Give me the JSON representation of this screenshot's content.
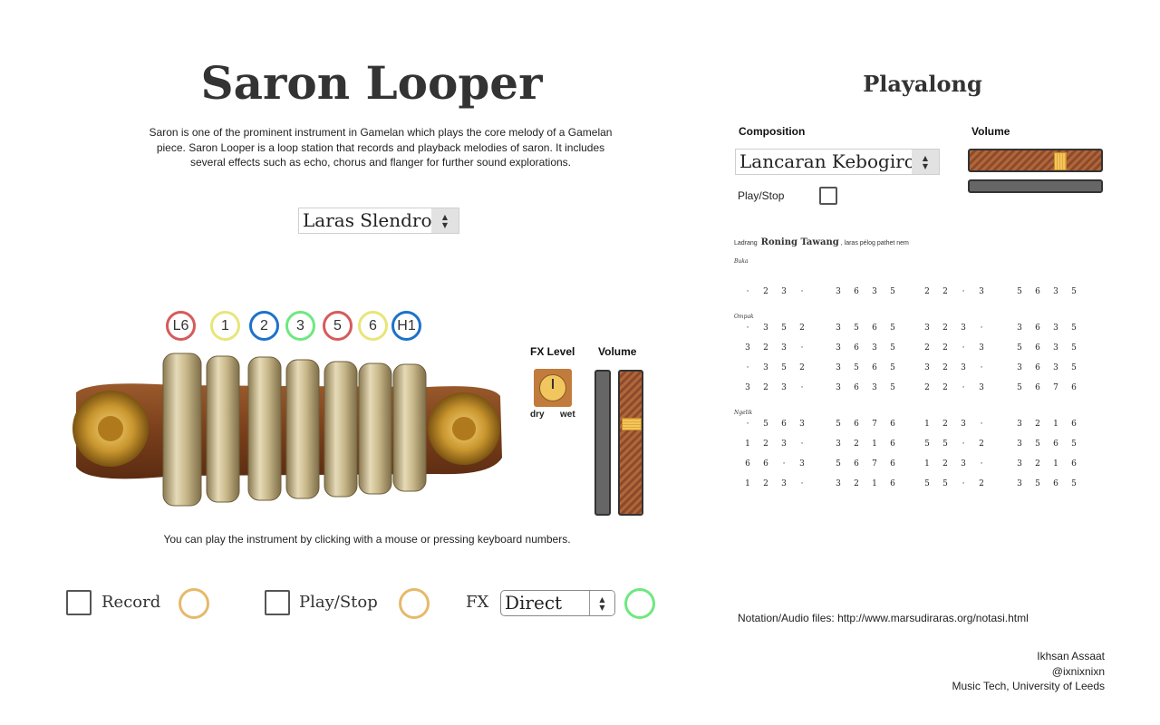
{
  "app": {
    "title": "Saron Looper",
    "description": "Saron is one of the prominent instrument in Gamelan which plays the core melody of a Gamelan piece. Saron Looper is a loop station that records and playback melodies of saron. It includes several effects such as echo, chorus and flanger for further sound explorations.",
    "laras_select": "Laras Slendro",
    "notes": [
      {
        "label": "L6",
        "color": "#d65b5b"
      },
      {
        "label": "1",
        "color": "#e8e57a"
      },
      {
        "label": "2",
        "color": "#1d72c9"
      },
      {
        "label": "3",
        "color": "#6ee87f"
      },
      {
        "label": "5",
        "color": "#d65b5b"
      },
      {
        "label": "6",
        "color": "#e8e57a"
      },
      {
        "label": "H1",
        "color": "#1d72c9"
      }
    ],
    "fx_level_label": "FX Level",
    "fx_dry": "dry",
    "fx_wet": "wet",
    "volume_label": "Volume",
    "hint": "You can play the instrument by clicking with a mouse or pressing keyboard numbers.",
    "record_label": "Record",
    "playstop_label": "Play/Stop",
    "fx_label": "FX",
    "fx_select": "Direct",
    "record_ring_color": "#e6b96a",
    "play_ring_color": "#e6b96a",
    "fx_ring_color": "#6ee87f",
    "volume_level_fraction": 0.65
  },
  "playalong": {
    "title": "Playalong",
    "composition_label": "Composition",
    "composition_select": "Lancaran Kebogiro",
    "volume_label": "Volume",
    "volume_level_fraction": 0.7,
    "playstop_label": "Play/Stop",
    "notation": {
      "header_prefix": "Ladrang",
      "header_title": "Roning Tawang",
      "header_suffix": ", laras pélog pathet nem",
      "buka_label": "Buka",
      "ompak_label": "Ompak",
      "ngelik_label": "Ngelik",
      "buka_rows": [
        [
          "·",
          "2",
          "3",
          "·",
          "3",
          "6",
          "3",
          "5",
          "2",
          "2",
          "·",
          "3",
          "5",
          "6",
          "3",
          "5"
        ]
      ],
      "ompak_rows": [
        [
          "·",
          "3",
          "5",
          "2",
          "3",
          "5",
          "6",
          "5",
          "3",
          "2",
          "3",
          "·",
          "3",
          "6",
          "3",
          "5"
        ],
        [
          "3",
          "2",
          "3",
          "·",
          "3",
          "6",
          "3",
          "5",
          "2",
          "2",
          "·",
          "3",
          "5",
          "6",
          "3",
          "5"
        ],
        [
          "·",
          "3",
          "5",
          "2",
          "3",
          "5",
          "6",
          "5",
          "3",
          "2",
          "3",
          "·",
          "3",
          "6",
          "3",
          "5"
        ],
        [
          "3",
          "2",
          "3",
          "·",
          "3",
          "6",
          "3",
          "5",
          "2",
          "2",
          "·",
          "3",
          "5",
          "6",
          "7",
          "6"
        ]
      ],
      "ngelik_rows": [
        [
          "·",
          "5",
          "6",
          "3",
          "5",
          "6",
          "7",
          "6",
          "1",
          "2",
          "3",
          "·",
          "3",
          "2",
          "1",
          "6"
        ],
        [
          "1",
          "2",
          "3",
          "·",
          "3",
          "2",
          "1",
          "6",
          "5",
          "5",
          "·",
          "2",
          "3",
          "5",
          "6",
          "5"
        ],
        [
          "6",
          "6",
          "·",
          "3",
          "5",
          "6",
          "7",
          "6",
          "1",
          "2",
          "3",
          "·",
          "3",
          "2",
          "1",
          "6"
        ],
        [
          "1",
          "2",
          "3",
          "·",
          "3",
          "2",
          "1",
          "6",
          "5",
          "5",
          "·",
          "2",
          "3",
          "5",
          "6",
          "5"
        ]
      ]
    },
    "source": "Notation/Audio files: http://www.marsudiraras.org/notasi.html"
  },
  "credits": {
    "name": "Ikhsan Assaat",
    "handle": "@ixnixnixn",
    "affiliation": "Music Tech, University of Leeds"
  }
}
